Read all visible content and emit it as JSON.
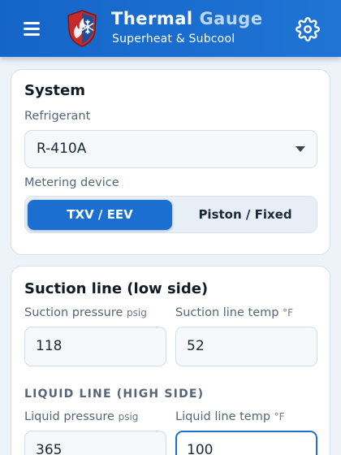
{
  "header": {
    "title_part1": "Thermal",
    "title_part2": "Gauge",
    "subtitle": "Superheat & Subcool",
    "menu_icon": "hamburger-menu-icon",
    "settings_icon": "gear-icon",
    "logo": "flame-snowflake-shield-logo"
  },
  "colors": {
    "header_bg": "#1a6fd1",
    "accent": "#1a6fd1",
    "title_secondary": "#bcd7f5",
    "page_bg": "#eef3f9"
  },
  "system": {
    "title": "System",
    "refrigerant_label": "Refrigerant",
    "refrigerant_value": "R-410A",
    "metering_label": "Metering device",
    "metering_options": [
      "TXV / EEV",
      "Piston / Fixed"
    ],
    "metering_selected": "TXV / EEV"
  },
  "suction": {
    "title": "Suction line (low side)",
    "pressure_label": "Suction pressure",
    "pressure_unit": "psig",
    "pressure_value": "118",
    "temp_label": "Suction line temp",
    "temp_unit": "°F",
    "temp_value": "52"
  },
  "liquid": {
    "title": "LIQUID LINE (HIGH SIDE)",
    "pressure_label": "Liquid pressure",
    "pressure_unit": "psig",
    "pressure_value": "365",
    "temp_label": "Liquid line temp",
    "temp_unit": "°F",
    "temp_value": "100"
  }
}
